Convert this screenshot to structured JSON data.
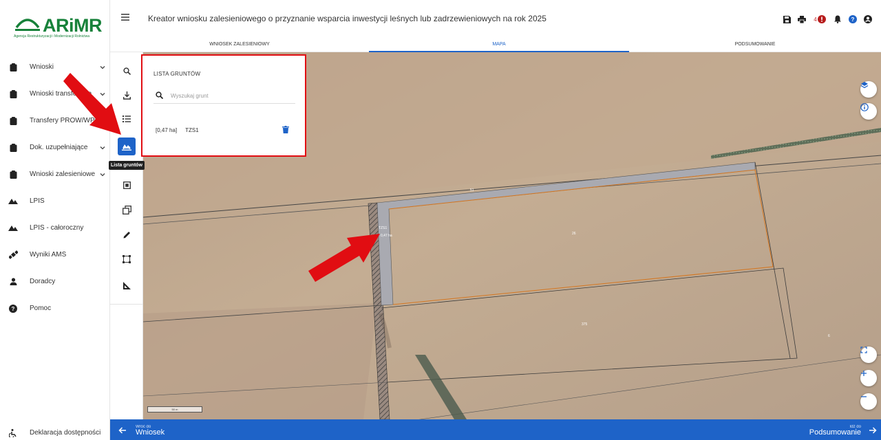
{
  "app": {
    "title": "Kreator wniosku zalesieniowego o przyznanie wsparcia inwestycji leśnych lub zadrzewieniowych na rok 2025",
    "notifications_count": "4"
  },
  "logo": {
    "name": "ARiMR",
    "subtitle": "Agencja Restrukturyzacji i Modernizacji Rolnictwa"
  },
  "sidebar": {
    "items": [
      {
        "label": "Wnioski",
        "icon": "clipboard-icon",
        "has_chevron": true
      },
      {
        "label": "Wnioski transferowe",
        "icon": "clipboard-icon",
        "has_chevron": true
      },
      {
        "label": "Transfery PROW/WPR",
        "icon": "clipboard-icon",
        "has_chevron": false
      },
      {
        "label": "Dok. uzupełniające",
        "icon": "clipboard-icon",
        "has_chevron": true
      },
      {
        "label": "Wnioski zalesieniowe",
        "icon": "clipboard-icon",
        "has_chevron": true
      },
      {
        "label": "LPIS",
        "icon": "terrain-icon",
        "has_chevron": false
      },
      {
        "label": "LPIS - całoroczny",
        "icon": "terrain-icon",
        "has_chevron": false
      },
      {
        "label": "Wyniki AMS",
        "icon": "satellite-icon",
        "has_chevron": false
      },
      {
        "label": "Doradcy",
        "icon": "person-icon",
        "has_chevron": false
      },
      {
        "label": "Pomoc",
        "icon": "help-icon",
        "has_chevron": false
      }
    ],
    "footer_label": "Deklaracja dostępności"
  },
  "tabs": [
    {
      "label": "WNIOSEK ZALESIENIOWY",
      "active": false
    },
    {
      "label": "MAPA",
      "active": true
    },
    {
      "label": "PODSUMOWANIE",
      "active": false
    }
  ],
  "tools": {
    "tooltip": "Lista gruntów",
    "items": [
      "search-icon",
      "download-icon",
      "list-icon",
      "parcels-icon",
      "select-frame-icon",
      "copy-icon",
      "pencil-icon",
      "bounding-box-icon",
      "measure-icon"
    ]
  },
  "panel": {
    "title": "LISTA GRUNTÓW",
    "search_placeholder": "Wyszukaj grunt",
    "parcel_area": "[0,47 ha]",
    "parcel_name": "TZS1"
  },
  "map": {
    "labels": {
      "parcel_tag": "TZS1",
      "parcel_area": "0,47 ha",
      "plot_51": "51",
      "plot_26": "26",
      "plot_375": "375",
      "plot_6": "6"
    },
    "scale_label": "50 m"
  },
  "bottom": {
    "back_small": "Wróć do",
    "back_big": "Wniosek",
    "next_small": "Idź do",
    "next_big": "Podsumowanie"
  },
  "colors": {
    "accent": "#1e63c8",
    "logo_green": "#17813a",
    "annotation_red": "#e10d12"
  }
}
